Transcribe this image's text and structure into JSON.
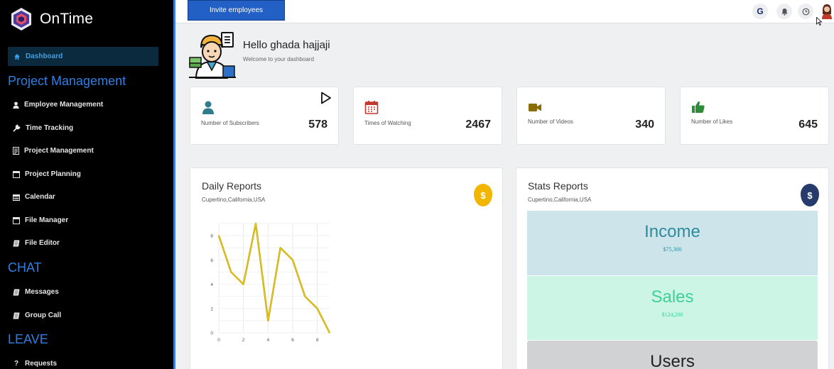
{
  "sidebar": {
    "brand": "OnTime",
    "active_item": "Dashboard",
    "sections": {
      "project_management": "Project Management",
      "chat": "CHAT",
      "leave": "LEAVE"
    },
    "items": [
      {
        "label": "Employee Management",
        "icon": "user-icon"
      },
      {
        "label": "Time Tracking",
        "icon": "wrench-icon"
      },
      {
        "label": "Project Management",
        "icon": "document-icon"
      },
      {
        "label": "Project Planning",
        "icon": "window-icon"
      },
      {
        "label": "Calendar",
        "icon": "calendar-icon"
      },
      {
        "label": "File Manager",
        "icon": "window-icon"
      },
      {
        "label": "File Editor",
        "icon": "file-icon"
      },
      {
        "label": "Messages",
        "icon": "file-icon"
      },
      {
        "label": "Group Call",
        "icon": "file-icon"
      },
      {
        "label": "Requests",
        "icon": "question-icon"
      }
    ]
  },
  "topbar": {
    "invite_label": "Invite employees",
    "g_label": "G"
  },
  "greeting": {
    "title": "Hello ghada hajjaji",
    "subtitle": "Welcome to your dashboard"
  },
  "stats": [
    {
      "label": "Number of Subscribers",
      "value": "578",
      "icon": "user-icon",
      "color": "#2f7d8c"
    },
    {
      "label": "Times of Watching",
      "value": "2467",
      "icon": "calendar-icon",
      "color": "#c0392b"
    },
    {
      "label": "Number of Videos",
      "value": "340",
      "icon": "video-camera-icon",
      "color": "#8a6d00"
    },
    {
      "label": "Number of Likes",
      "value": "645",
      "icon": "thumbs-up-icon",
      "color": "#2e8b3a"
    }
  ],
  "daily_reports": {
    "title": "Daily Reports",
    "subtitle": "Cupertino,California,USA",
    "badge": "$"
  },
  "stats_reports": {
    "title": "Stats Reports",
    "subtitle": "Cupertino,California,USA",
    "badge": "$",
    "blocks": [
      {
        "title": "Income",
        "value": "$75,300"
      },
      {
        "title": "Sales",
        "value": "$124,200"
      },
      {
        "title": "Users",
        "value": ""
      }
    ]
  },
  "colors": {
    "accent": "#2f7fe0",
    "line": "#e6c619",
    "income_bg": "#cde5ea",
    "income_text": "#2f8a9c",
    "sales_bg": "#cdf5e6",
    "sales_text": "#3fd09a",
    "users_bg": "#d0d2d4"
  },
  "chart_data": {
    "type": "line",
    "x": [
      0,
      1,
      2,
      3,
      4,
      5,
      6,
      7,
      8,
      9
    ],
    "series": [
      {
        "values": [
          8,
          5,
          4,
          9,
          1,
          7,
          6,
          3,
          2,
          0
        ]
      }
    ],
    "xticks": [
      "0",
      "2",
      "4",
      "6",
      "8"
    ],
    "yticks": [
      "0",
      "2",
      "4",
      "6",
      "8"
    ],
    "xlim": [
      0,
      9
    ],
    "ylim": [
      0,
      9
    ],
    "grid": true
  }
}
